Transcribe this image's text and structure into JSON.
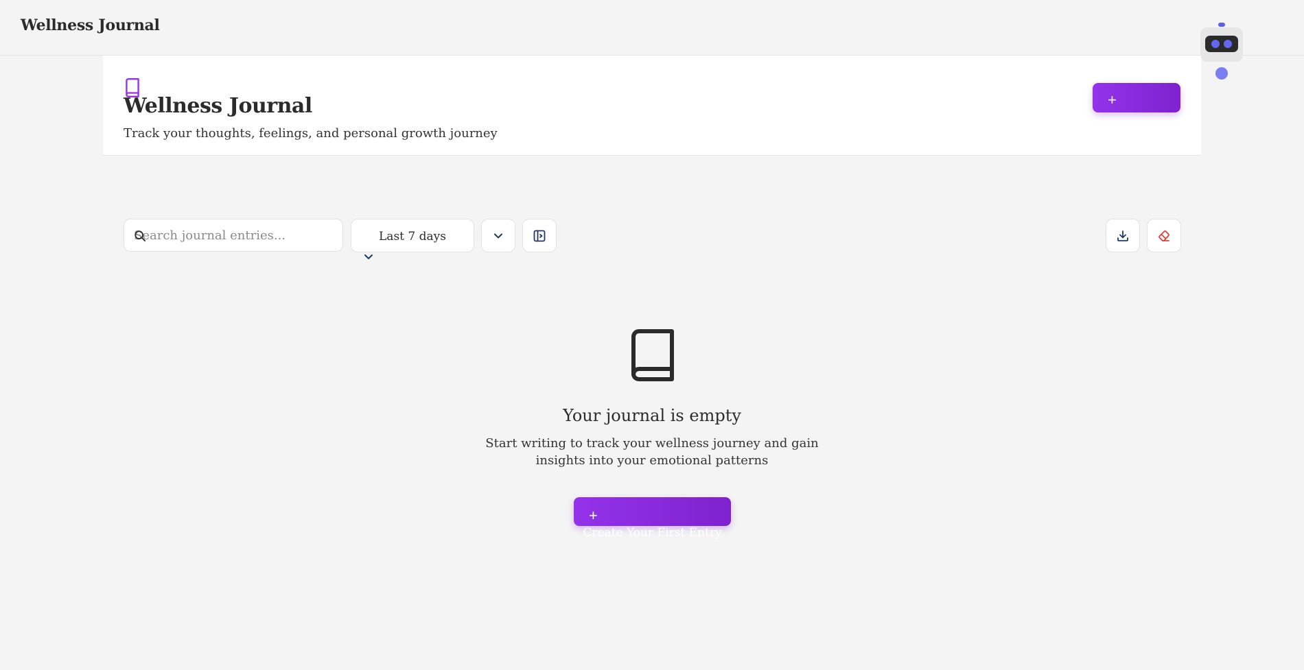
{
  "topbar": {
    "brand": "Wellness Journal"
  },
  "hero": {
    "icon": "book-icon",
    "title": "Wellness Journal",
    "subtitle": "Track your thoughts, feelings, and personal growth journey",
    "new_entry_icon": "plus"
  },
  "toolbar": {
    "search": {
      "placeholder": "Search journal entries...",
      "value": "",
      "icon": "search-icon"
    },
    "date_range": {
      "selected": "Last 7 days"
    },
    "buttons": [
      "chevron-down-icon",
      "panel-toggle-icon",
      "download-icon",
      "eraser-icon"
    ]
  },
  "empty_state": {
    "icon": "book-icon",
    "title": "Your journal is empty",
    "text": "Start writing to track your wellness journey and gain insights into your emotional patterns",
    "button_label": "Create Your First Entry"
  },
  "colors": {
    "accent": "#9333ea",
    "accent_dark": "#7e22ce",
    "robot_eye": "#6366f1",
    "danger": "#e53e3e"
  }
}
